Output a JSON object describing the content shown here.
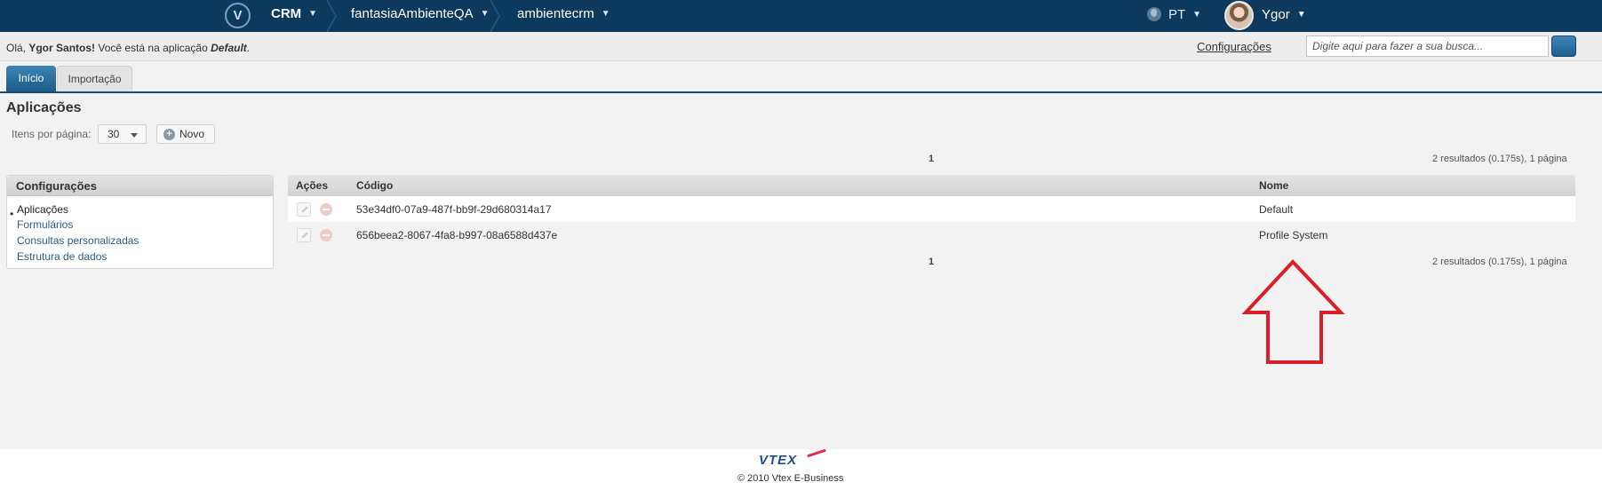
{
  "topbar": {
    "logo_letter": "V",
    "crumbs": [
      "CRM",
      "fantasiaAmbienteQA",
      "ambientecrm"
    ],
    "language": "PT",
    "user_name": "Ygor"
  },
  "welcome": {
    "prefix": "Olá, ",
    "user_full_name": "Ygor Santos!",
    "middle": " Você está na aplicação ",
    "app_name": "Default",
    "suffix": "."
  },
  "header_links": {
    "config": "Configurações",
    "search_placeholder": "Digite aqui para fazer a sua busca..."
  },
  "tabs": [
    {
      "label": "Início",
      "active": true
    },
    {
      "label": "Importação",
      "active": false
    }
  ],
  "page": {
    "title": "Aplicações",
    "per_page_label": "Itens por página:",
    "per_page_value": "30",
    "new_label": "Novo"
  },
  "pagination": {
    "current_page": "1",
    "summary": "2 resultados (0.175s), 1 página"
  },
  "sidebar": {
    "title": "Configurações",
    "items": [
      "Aplicações",
      "Formulários",
      "Consultas personalizadas",
      "Estrutura de dados"
    ]
  },
  "table": {
    "columns": [
      "Ações",
      "Código",
      "Nome"
    ],
    "rows": [
      {
        "code": "53e34df0-07a9-487f-bb9f-29d680314a17",
        "name": "Default"
      },
      {
        "code": "656beea2-8067-4fa8-b997-08a6588d437e",
        "name": "Profile System"
      }
    ]
  },
  "footer": {
    "logo": "VTEX",
    "copyright": "© 2010 Vtex E-Business"
  },
  "colors": {
    "topbar": "#0d3a5c",
    "accent": "#1f4e72",
    "annotation_arrow": "#d9202a"
  }
}
